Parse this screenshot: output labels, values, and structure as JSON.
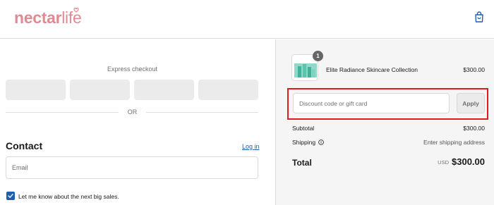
{
  "header": {
    "logo_bold": "nectar",
    "logo_light": "life",
    "cart_icon": "shopping-bag-icon"
  },
  "express": {
    "title": "Express checkout",
    "or_label": "OR"
  },
  "contact": {
    "title": "Contact",
    "login_label": "Log in",
    "email_placeholder": "Email",
    "marketing_label": "Let me know about the next big sales.",
    "marketing_checked": true
  },
  "order": {
    "product_name": "Elite Radiance Skincare Collection",
    "product_price": "$300.00",
    "quantity": "1",
    "discount_placeholder": "Discount code or gift card",
    "apply_label": "Apply",
    "subtotal_label": "Subtotal",
    "subtotal_value": "$300.00",
    "shipping_label": "Shipping",
    "shipping_value": "Enter shipping address",
    "total_label": "Total",
    "total_currency": "USD",
    "total_value": "$300.00"
  },
  "colors": {
    "brand": "#e08a94",
    "link": "#1f5fae",
    "highlight": "#e01b24",
    "summary_bg": "#f5f5f5"
  }
}
